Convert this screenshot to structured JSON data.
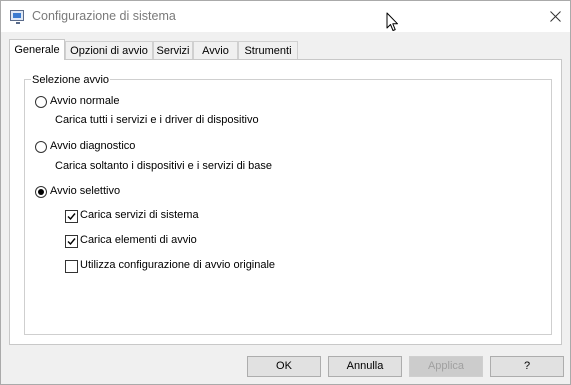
{
  "window": {
    "title": "Configurazione di sistema"
  },
  "tabs": [
    {
      "label": "Generale",
      "active": true
    },
    {
      "label": "Opzioni di avvio",
      "active": false
    },
    {
      "label": "Servizi",
      "active": false
    },
    {
      "label": "Avvio",
      "active": false
    },
    {
      "label": "Strumenti",
      "active": false
    }
  ],
  "group": {
    "label": "Selezione avvio",
    "options": [
      {
        "label": "Avvio normale",
        "description": "Carica tutti i servizi e i driver di dispositivo",
        "selected": false
      },
      {
        "label": "Avvio diagnostico",
        "description": "Carica soltanto i dispositivi e i servizi di base",
        "selected": false
      },
      {
        "label": "Avvio selettivo",
        "selected": true
      }
    ],
    "checkboxes": [
      {
        "label": "Carica servizi di sistema",
        "checked": true
      },
      {
        "label": "Carica elementi di avvio",
        "checked": true
      },
      {
        "label": "Utilizza configurazione di avvio originale",
        "checked": false
      }
    ]
  },
  "buttons": {
    "ok": "OK",
    "cancel": "Annulla",
    "apply": "Applica",
    "help": "?"
  },
  "icons": {
    "app": "msconfig-icon",
    "close": "close-icon",
    "cursor": "mouse-cursor-icon"
  }
}
